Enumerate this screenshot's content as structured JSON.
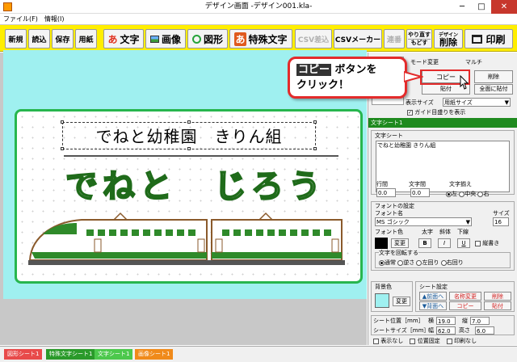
{
  "window": {
    "title": "デザイン画面 -デザイン001.kla-",
    "minimize": "─",
    "maximize": "□",
    "close": "✕"
  },
  "menu": [
    "ファイル(F)",
    "情報(I)"
  ],
  "toolbar": {
    "new": "新規",
    "open": "読込",
    "save": "保存",
    "paper": "用紙",
    "text": "文字",
    "image": "画像",
    "shape": "図形",
    "special_text": "特殊文字",
    "csv_insert": "CSV差込",
    "csv_maker": "CSVメーカー",
    "consecutive": "連番",
    "undo_redo": [
      "やり直す",
      "もどす"
    ],
    "design": "デザイン",
    "delete": "削除",
    "print": "印刷",
    "text_icon": "あ",
    "special_icon": "あ"
  },
  "canvas": {
    "text_line": "でねと幼稚園　きりん組",
    "big_text": "でねと　じろう"
  },
  "callout": {
    "line1_highlight": "コピー",
    "line1_rest": "ボタンを",
    "line2": "クリック！"
  },
  "panel": {
    "mode_label": "モード変更",
    "multi_label": "マルチ",
    "copy": "コピー",
    "paste": "貼付",
    "delete": "削除",
    "paste_all": "全面に貼付",
    "view_size_label": "表示サイズ",
    "view_size_value": "用紙サイズ",
    "guide_label": "ガイド目盛りを表示",
    "sheet_title": "文字シート1",
    "text_sheet_label": "文字シート",
    "text_value": "でねと幼稚園 きりん組",
    "line_spacing_label": "行間",
    "line_spacing_value": "0.0",
    "char_spacing_label": "文字間",
    "char_spacing_value": "0.0",
    "align_label": "文字揃え",
    "align_options": [
      "左",
      "中央",
      "右"
    ],
    "font_settings_label": "フォントの設定",
    "font_name_label": "フォント名",
    "font_name_value": "MS ゴシック",
    "size_label": "サイズ",
    "size_value": "16",
    "font_color_label": "フォント色",
    "bold_label": "太字",
    "italic_label": "斜体",
    "underline_label": "下線",
    "change": "変更",
    "b": "B",
    "i": "I",
    "u": "U",
    "vertical_label": "縦書き",
    "rotate_label": "文字を回転する",
    "rotate_options": [
      "通常",
      "逆さ",
      "左回り",
      "右回り"
    ],
    "bg_color_label": "背景色",
    "bg_change": "変更",
    "sheet_settings_label": "シート設定",
    "to_front": "▲前面へ",
    "to_back": "▼背面へ",
    "rename": "名称変更",
    "copy2": "コピー",
    "delete2": "削除",
    "paste2": "貼付",
    "pos_label": "シート位置［mm］",
    "x_label": "横",
    "x_value": "19.0",
    "y_label": "縦",
    "y_value": "7.0",
    "size_mm_label": "シートサイズ［mm］",
    "w_label": "幅",
    "w_value": "62.0",
    "h_label": "高さ",
    "h_value": "6.0",
    "hide_label": "表示なし",
    "lock_label": "位置固定",
    "noprint_label": "印刷なし"
  },
  "status_tabs": [
    {
      "label": "図形シート1",
      "color": "#e84a4a"
    },
    {
      "label": "特殊文字シート1",
      "color": "#2a9a2a"
    },
    {
      "label": "文字シート1",
      "color": "#4cc84c"
    },
    {
      "label": "画像シート1",
      "color": "#f08a1a"
    }
  ],
  "colors": {
    "toolbar": "#ffee00",
    "canvas": "#9ff0f0",
    "frame": "#27b64e",
    "accent_red": "#e32b2b",
    "train_green": "#2f8a2a"
  }
}
